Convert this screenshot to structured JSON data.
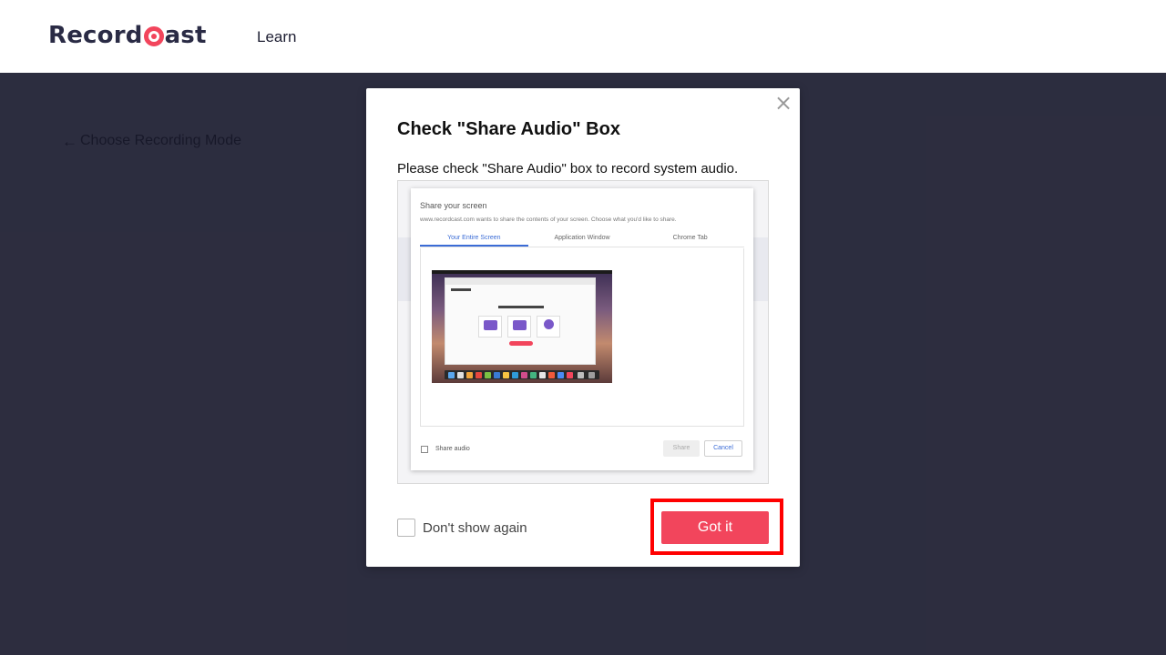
{
  "header": {
    "logo_text_pre": "Record",
    "logo_text_post": "ast",
    "nav_learn": "Learn"
  },
  "page": {
    "back_link": "Choose Recording Mode"
  },
  "modal": {
    "close_symbol": "×",
    "title": "Check \"Share Audio\" Box",
    "description": "Please check \"Share Audio\" box to record system audio.",
    "illustration": {
      "dialog_title": "Share your screen",
      "dialog_subtitle": "www.recordcast.com wants to share the contents of your screen. Choose what you'd like to share.",
      "tabs": [
        "Your Entire Screen",
        "Application Window",
        "Chrome Tab"
      ],
      "active_tab": "Your Entire Screen",
      "share_audio_label": "Share audio",
      "share_button": "Share",
      "cancel_button": "Cancel"
    },
    "dont_show_label": "Don't show again",
    "got_it_label": "Got it"
  },
  "colors": {
    "brand_accent": "#f2455c",
    "page_background": "#2b2b3f",
    "highlight_border": "#ff0000",
    "dialog_tab_active": "#3b6cd6"
  },
  "icons": {
    "back": "arrow-left-icon",
    "close": "close-icon",
    "logo": "record-circle-icon"
  }
}
